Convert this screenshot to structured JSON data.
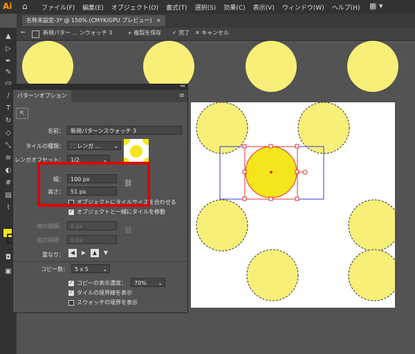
{
  "app": {
    "logo": "Ai",
    "home_icon": "home-icon",
    "workspace_icon": "grid-icon"
  },
  "menu": [
    "ファイル(F)",
    "編集(E)",
    "オブジェクト(O)",
    "書式(T)",
    "選択(S)",
    "効果(C)",
    "表示(V)",
    "ウィンドウ(W)",
    "ヘルプ(H)"
  ],
  "document_tab": {
    "title": "名称未設定-3* @ 150% (CMYK/GPU プレビュー)",
    "close": "×"
  },
  "pattern_bar": {
    "back": "←",
    "name": "新規パター ... ンウォッチ 3",
    "save_copy": "+ 複製を保存",
    "done": "✓ 完了",
    "cancel": "✕ キャンセル"
  },
  "panel": {
    "title": "パターンオプション",
    "menu_icon": "≡",
    "close": "◂◂",
    "name_label": "名前：",
    "name_value": "新規パターンスウォッチ 3",
    "tile_type_label": "タイルの種類：",
    "tile_type_value": "レンガ ...",
    "brick_offset_label": "レンガオフセット：",
    "brick_offset_value": "1/2",
    "width_label": "幅：",
    "width_value": "100 px",
    "height_label": "高さ：",
    "height_value": "51 px",
    "fit_tile_label": "オブジェクトにタイルサイズを合わせる",
    "move_tile_label": "オブジェクトと一緒にタイルを移動",
    "h_spacing_label": "横の間隔：",
    "h_spacing_value": "0 px",
    "v_spacing_label": "縦の間隔：",
    "v_spacing_value": "0 px",
    "overlap_label": "重なり：",
    "copies_label": "コピー数：",
    "copies_value": "5 x 5",
    "dim_copies_label": "コピーの表示濃度：",
    "dim_copies_value": "70%",
    "show_tile_edge_label": "タイルの境界線を表示",
    "show_swatch_bounds_label": "スウォッチの境界を表示"
  },
  "colors": {
    "accent_yellow": "#f8ef78",
    "selected_yellow": "#f5e51c",
    "highlight_red": "#e00000",
    "tile_blue": "#3a3ad8"
  }
}
